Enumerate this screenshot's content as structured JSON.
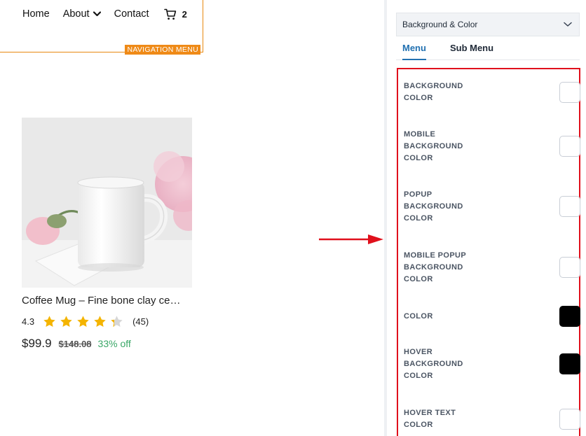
{
  "nav": {
    "items": [
      "Home",
      "About",
      "Contact"
    ],
    "cart_count": "2",
    "tag": "NAVIGATION MENU"
  },
  "product": {
    "title": "Coffee Mug – Fine bone clay ce…",
    "rating": "4.3",
    "stars_value": 4.3,
    "stars_max": 5,
    "review_count": "(45)",
    "price": "$99.9",
    "old_price": "$148.08",
    "discount": "33% off"
  },
  "panel": {
    "section_title": "Background & Color",
    "tabs": [
      "Menu",
      "Sub Menu"
    ],
    "active_tab": "Menu",
    "settings": [
      {
        "label": "BACKGROUND COLOR",
        "color": "#ffffff"
      },
      {
        "label": "MOBILE BACKGROUND COLOR",
        "color": "#ffffff"
      },
      {
        "label": "POPUP BACKGROUND COLOR",
        "color": "#ffffff"
      },
      {
        "label": "MOBILE POPUP BACKGROUND COLOR",
        "color": "#ffffff"
      },
      {
        "label": "COLOR",
        "color": "#000000"
      },
      {
        "label": "HOVER BACKGROUND COLOR",
        "color": "#000000"
      },
      {
        "label": "HOVER TEXT COLOR",
        "color": "#ffffff"
      }
    ]
  },
  "colors": {
    "accent": "#2271b1",
    "highlight": "#e0101c",
    "nav_tag": "#ef8a17",
    "star": "#f4b400",
    "discount": "#3aa767"
  }
}
